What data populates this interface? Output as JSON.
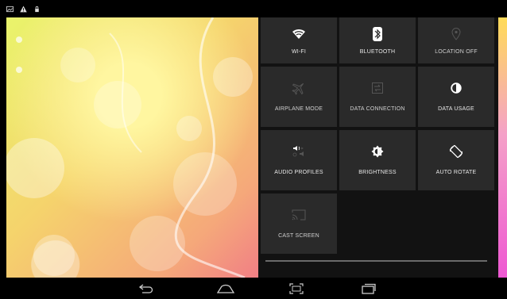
{
  "quick_settings": {
    "tiles": [
      {
        "label": "WI-FI",
        "icon": "wifi-icon",
        "state": "on"
      },
      {
        "label": "BLUETOOTH",
        "icon": "bluetooth-icon",
        "state": "on"
      },
      {
        "label": "LOCATION OFF",
        "icon": "location-icon",
        "state": "off"
      },
      {
        "label": "AIRPLANE MODE",
        "icon": "airplane-icon",
        "state": "off"
      },
      {
        "label": "DATA CONNECTION",
        "icon": "data-connection-icon",
        "state": "off"
      },
      {
        "label": "DATA USAGE",
        "icon": "data-usage-icon",
        "state": "on"
      },
      {
        "label": "AUDIO PROFILES",
        "icon": "audio-profiles-icon",
        "state": "on"
      },
      {
        "label": "BRIGHTNESS",
        "icon": "brightness-icon",
        "state": "on"
      },
      {
        "label": "AUTO ROTATE",
        "icon": "auto-rotate-icon",
        "state": "on"
      },
      {
        "label": "CAST SCREEN",
        "icon": "cast-screen-icon",
        "state": "off"
      }
    ]
  },
  "status_bar": {
    "icons": [
      "image-notification-icon",
      "warning-icon",
      "lock-icon"
    ]
  },
  "nav_bar": {
    "buttons": [
      "back-icon",
      "home-icon",
      "screenshot-icon",
      "recents-icon"
    ]
  },
  "colors": {
    "panel_bg": "#121212",
    "tile_bg": "#2a2a2a",
    "text": "#e8e8e8"
  }
}
